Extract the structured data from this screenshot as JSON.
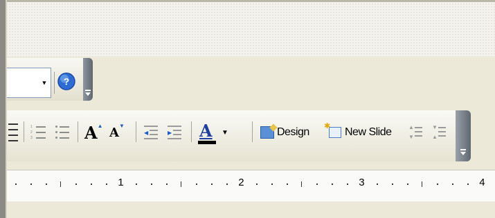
{
  "toolbar_top": {
    "combo_value": "",
    "dropdown_arrow_glyph": "▾",
    "help_icon": "help-icon",
    "overflow_chevron_glyph": "»"
  },
  "toolbar_formatting": {
    "font_grow_label": "A",
    "font_shrink_label": "A",
    "font_color_label": "A",
    "font_color_dropdown_glyph": "▾",
    "design_label": "Design",
    "new_slide_label": "New Slide",
    "overflow_chevron_glyph": "»"
  },
  "ruler": {
    "numbers": [
      "1",
      "2",
      "3",
      "4"
    ]
  },
  "colors": {
    "toolbar_chevron": "#5E6670",
    "font_color_bar": "#000000",
    "accent_blue": "#1E5BC6"
  }
}
